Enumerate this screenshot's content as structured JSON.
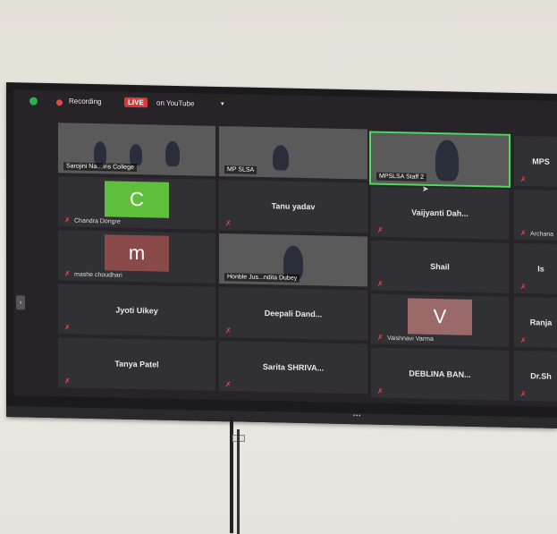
{
  "topbar": {
    "recording_label": "Recording",
    "live_badge": "LIVE",
    "stream_label": "on YouTube",
    "caret": "▾"
  },
  "tiles": [
    {
      "kind": "video",
      "caption": "Sarojini Na…iris College"
    },
    {
      "kind": "video",
      "caption": "MP SLSA"
    },
    {
      "kind": "video",
      "caption": "MPSLSA Staff 2"
    },
    {
      "kind": "name",
      "name": "MPS"
    },
    {
      "kind": "avatar",
      "letter": "C",
      "sub": "Chandra Dongre"
    },
    {
      "kind": "name",
      "name": "Tanu yadav"
    },
    {
      "kind": "name",
      "name": "Vaijyanti Dah..."
    },
    {
      "kind": "name",
      "name": "Archana"
    },
    {
      "kind": "avatar",
      "letter": "m",
      "sub": "mashe choudhari"
    },
    {
      "kind": "video",
      "caption": "Honble Jus...ndita Dubey"
    },
    {
      "kind": "name",
      "name": "Shail"
    },
    {
      "kind": "name",
      "name": "Is"
    },
    {
      "kind": "name",
      "name": "Jyoti Uikey"
    },
    {
      "kind": "name",
      "name": "Deepali Dand..."
    },
    {
      "kind": "avatar",
      "letter": "V",
      "sub": "Vaishnavi Varma"
    },
    {
      "kind": "name",
      "name": "Ranja"
    },
    {
      "kind": "name",
      "name": "Tanya Patel"
    },
    {
      "kind": "name",
      "name": "Sarita SHRIVA..."
    },
    {
      "kind": "name",
      "name": "DEBLINA BAN..."
    },
    {
      "kind": "name",
      "name": "Dr.Sh"
    }
  ],
  "colors": {
    "live": "#d83a3a",
    "speaker_highlight": "#4cd964",
    "avatar_c": "#5fbf3c",
    "avatar_m": "#8a4a4a",
    "avatar_v": "#9a6a6a",
    "mute_icon": "#e44444"
  },
  "icons": {
    "security": "shield-icon",
    "record": "record-dot-icon",
    "muted": "muted-mic-icon",
    "panel_toggle": "chevron-right-icon",
    "pointer": "mouse-cursor-icon"
  }
}
